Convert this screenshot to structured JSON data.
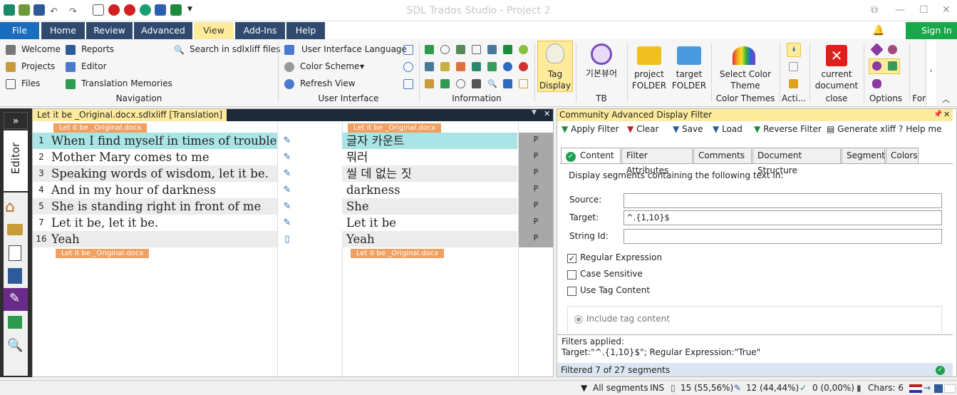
{
  "app": {
    "title": "SDL Trados Studio - Project 2"
  },
  "menu": {
    "tabs": [
      "File",
      "Home",
      "Review",
      "Advanced",
      "View",
      "Add-Ins",
      "Help"
    ],
    "active": "View",
    "sign_in": "Sign In"
  },
  "ribbon": {
    "navigation": {
      "items": [
        "Welcome",
        "Reports",
        "Projects",
        "Editor",
        "Files",
        "Translation Memories"
      ],
      "search": "Search in sdlxliff files",
      "group": "Navigation"
    },
    "user_interface": {
      "items": [
        "User Interface Language",
        "Color Scheme",
        "Refresh View"
      ],
      "group": "User Interface"
    },
    "information": {
      "group": "Information"
    },
    "tag_display": {
      "label1": "Tag",
      "label2": "Display"
    },
    "tb": {
      "label": "기본뷰어",
      "group": "TB"
    },
    "project_folder": {
      "label1": "project",
      "label2": "FOLDER"
    },
    "target_folder": {
      "label1": "target",
      "label2": "FOLDER"
    },
    "color_theme": {
      "label1": "Select Color",
      "label2": "Theme",
      "group": "Color Themes"
    },
    "actions": {
      "group": "Acti..."
    },
    "close": {
      "label1": "current",
      "label2": "document",
      "group": "close"
    },
    "options": {
      "group": "Options"
    },
    "font": {
      "group": "Fon"
    }
  },
  "editor": {
    "side_label": "Editor",
    "collapse": "»"
  },
  "document": {
    "tab": "Let it be _Original.docx.sdlxliff [Translation]",
    "tag_name": "Let it be _Original.docx",
    "rows": [
      {
        "n": "1",
        "source": "When I find myself in times of trouble",
        "target": "글자 카운트",
        "status": "P",
        "highlight": true
      },
      {
        "n": "2",
        "source": "Mother Mary comes to me",
        "target": "뭐러",
        "status": "P"
      },
      {
        "n": "3",
        "source": "Speaking words of wisdom, let it be.",
        "target": "씰 데 없는 짓",
        "status": "P"
      },
      {
        "n": "4",
        "source": "And in my hour of darkness",
        "target": "darkness",
        "status": "P"
      },
      {
        "n": "5",
        "source": "She is standing right in front of me",
        "target": "She",
        "status": "P"
      },
      {
        "n": "7",
        "source": "Let it be, let it be.",
        "target": "Let it be",
        "status": "P"
      },
      {
        "n": "16",
        "source": "Yeah",
        "target": "Yeah",
        "status": "P"
      }
    ]
  },
  "filter": {
    "title": "Community Advanced Display Filter",
    "toolbar": [
      "Apply Filter",
      "Clear",
      "Save",
      "Load",
      "Reverse Filter",
      "Generate xliff",
      "Help me"
    ],
    "tabs": [
      "Content",
      "Filter Attributes",
      "Comments",
      "Document Structure",
      "Segment",
      "Colors"
    ],
    "intro": "Display segments containing the following text in:",
    "source_label": "Source:",
    "target_label": "Target:",
    "string_id_label": "String Id:",
    "target_value": "^.{1,10}$",
    "options": [
      "Regular Expression",
      "Case Sensitive",
      "Use Tag Content"
    ],
    "include_tag": "Include tag content",
    "applied_title": "Filters applied:",
    "applied": "Target:\"^.{1,10}$\"; Regular Expression:\"True\"",
    "filtered": "Filtered 7 of 27 segments"
  },
  "status": {
    "all_segments": "All segments",
    "ins": "INS",
    "s1": "15 (55,56%)",
    "s2": "12 (44,44%)",
    "s3": "0 (0,00%)",
    "chars": "Chars: 6"
  }
}
